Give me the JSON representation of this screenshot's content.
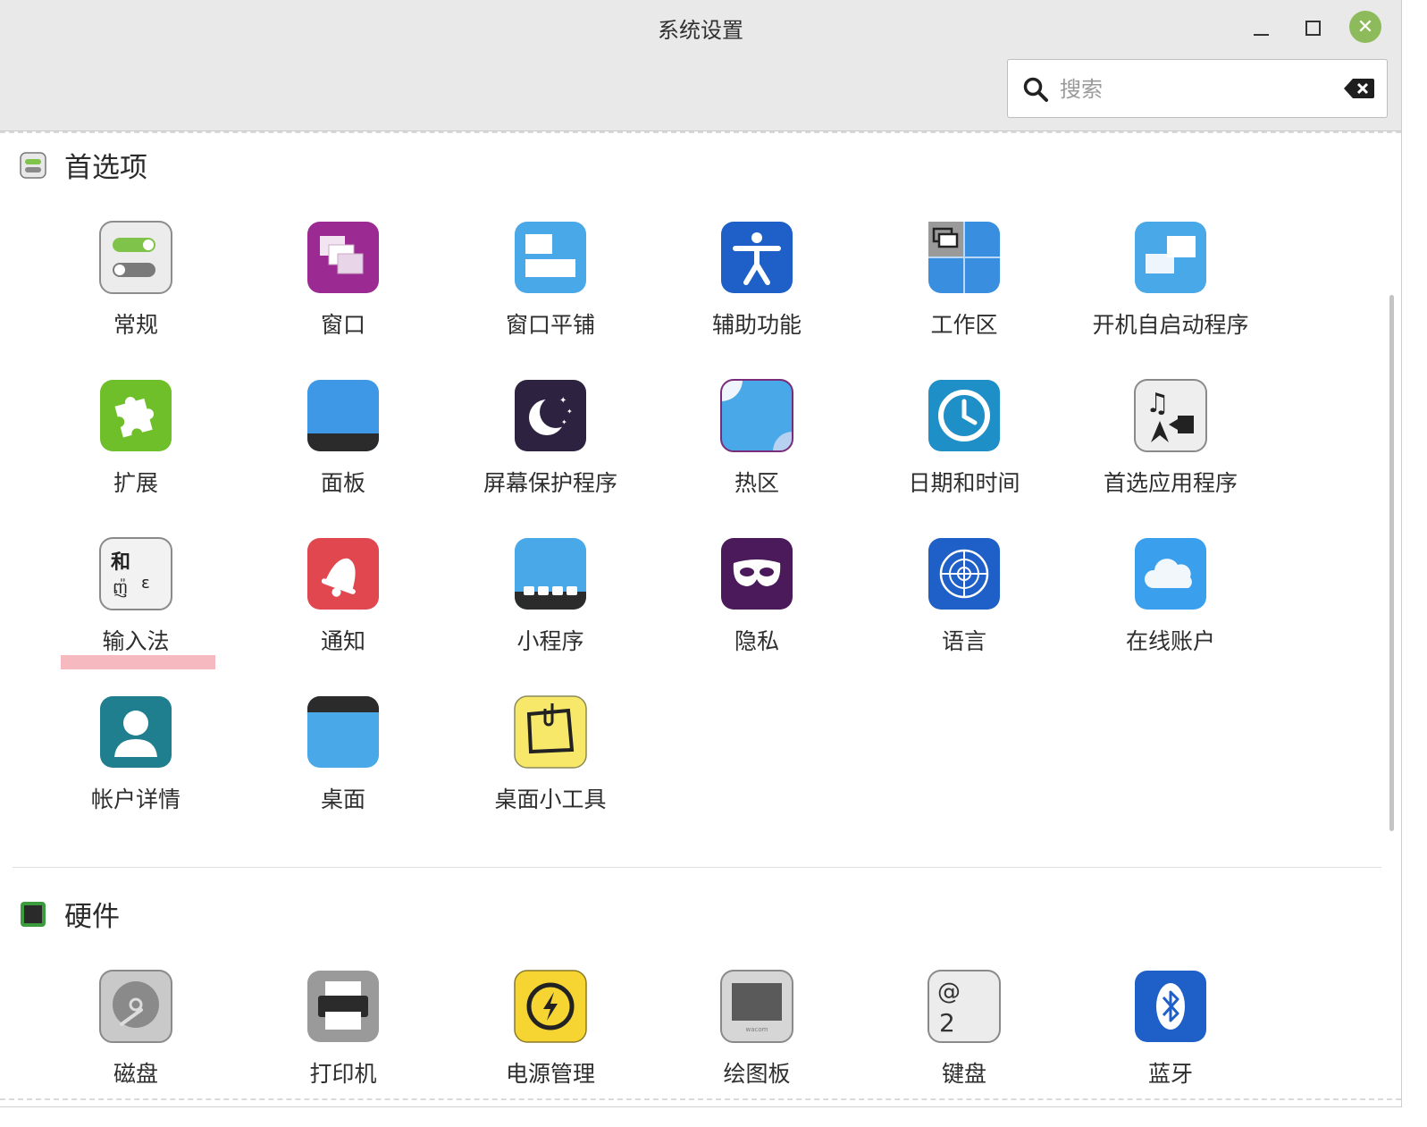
{
  "window": {
    "title": "系统设置"
  },
  "search": {
    "placeholder": "搜索",
    "value": ""
  },
  "sections": {
    "preferences": {
      "title": "首选项",
      "items": [
        "常规",
        "窗口",
        "窗口平铺",
        "辅助功能",
        "工作区",
        "开机自启动程序",
        "扩展",
        "面板",
        "屏幕保护程序",
        "热区",
        "日期和时间",
        "首选应用程序",
        "输入法",
        "通知",
        "小程序",
        "隐私",
        "语言",
        "在线账户",
        "帐户详情",
        "桌面",
        "桌面小工具"
      ]
    },
    "hardware": {
      "title": "硬件",
      "items": [
        "磁盘",
        "打印机",
        "电源管理",
        "绘图板",
        "键盘",
        "蓝牙"
      ]
    }
  },
  "input_method_icon_text": {
    "top": "和",
    "bottom_left": "ញ៉",
    "bottom_right": "ε"
  },
  "keyboard_icon_text": {
    "top": "@",
    "bottom": "2"
  },
  "tablet_brand": "wacom",
  "colors": {
    "close_button": "#8dbb5b",
    "highlight": "#f7b9c0",
    "accent_blue": "#2f8be0"
  }
}
